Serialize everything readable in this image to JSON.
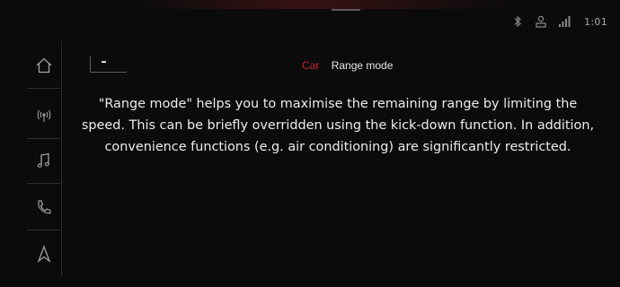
{
  "status_bar": {
    "icons": [
      "bluetooth-icon",
      "user-profile-icon",
      "signal-icon"
    ],
    "time": "1:01"
  },
  "sidebar": {
    "items": [
      {
        "name": "home",
        "icon": "home-icon"
      },
      {
        "name": "radio",
        "icon": "radio-icon"
      },
      {
        "name": "media",
        "icon": "music-note-icon"
      },
      {
        "name": "phone",
        "icon": "phone-icon"
      },
      {
        "name": "navigation",
        "icon": "navigation-arrow-icon"
      }
    ]
  },
  "header": {
    "back_icon": "back-icon",
    "breadcrumb_section": "Car",
    "title": "Range mode"
  },
  "content": {
    "message": "\"Range mode\" helps you to maximise the remaining range by limiting the speed. This can be briefly overridden using the kick-down function. In addition, convenience functions (e.g. air conditioning) are significantly restricted."
  },
  "colors": {
    "accent": "#c0232b",
    "background": "#0b0b0c",
    "text": "#ececec",
    "icon": "#9a9a9a"
  }
}
